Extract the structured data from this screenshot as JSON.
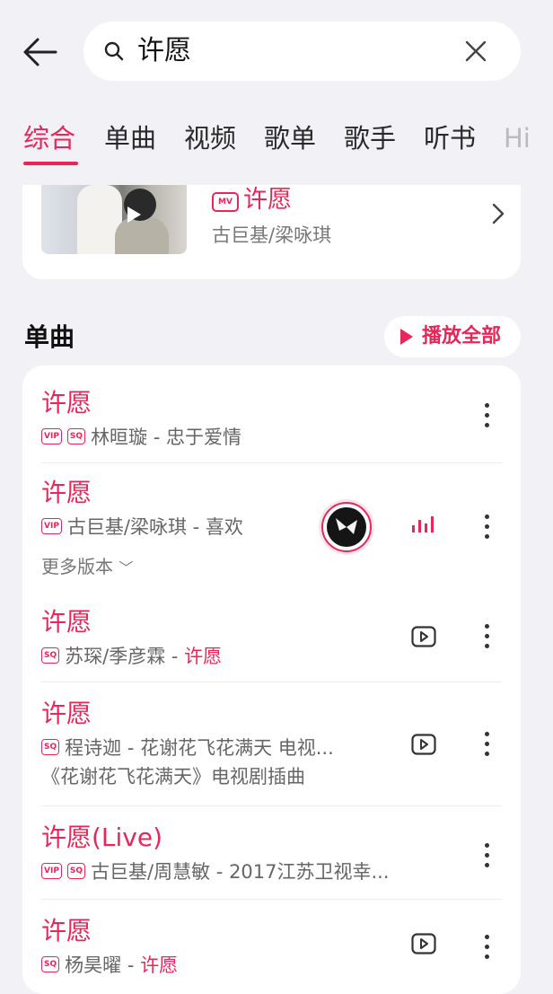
{
  "search": {
    "query": "许愿"
  },
  "tabs": [
    {
      "label": "综合",
      "active": true
    },
    {
      "label": "单曲",
      "active": false
    },
    {
      "label": "视频",
      "active": false
    },
    {
      "label": "歌单",
      "active": false
    },
    {
      "label": "歌手",
      "active": false
    },
    {
      "label": "听书",
      "active": false
    },
    {
      "label": "Hi",
      "active": false
    }
  ],
  "mv": {
    "badge": "MV",
    "title": "许愿",
    "artist": "古巨基/梁咏琪"
  },
  "songs_section": {
    "title": "单曲",
    "play_all_label": "播放全部"
  },
  "songs": [
    {
      "title": "许愿",
      "badges": [
        "VIP",
        "SQ"
      ],
      "subtitle": "林晅璇 - 忠于爱情"
    },
    {
      "title": "许愿",
      "badges": [
        "VIP"
      ],
      "subtitle": "古巨基/梁咏琪 - 喜欢",
      "more_versions": "更多版本",
      "playing": true
    },
    {
      "title": "许愿",
      "badges": [
        "SQ"
      ],
      "subtitle_prefix": "苏琛/季彦霖 - ",
      "subtitle_highlight": "许愿"
    },
    {
      "title": "许愿",
      "badges": [
        "SQ"
      ],
      "subtitle": "程诗迦 - 花谢花飞花满天 电视...",
      "extra": "《花谢花飞花满天》电视剧插曲"
    },
    {
      "title": "许愿(Live)",
      "badges": [
        "VIP",
        "SQ"
      ],
      "subtitle": "古巨基/周慧敏 - 2017江苏卫视幸..."
    },
    {
      "title": "许愿",
      "badges": [
        "SQ"
      ],
      "subtitle_prefix": "杨昊曜 - ",
      "subtitle_highlight": "许愿"
    }
  ],
  "colors": {
    "accent": "#e8265a",
    "background": "#f2f2f6",
    "card": "#ffffff"
  }
}
